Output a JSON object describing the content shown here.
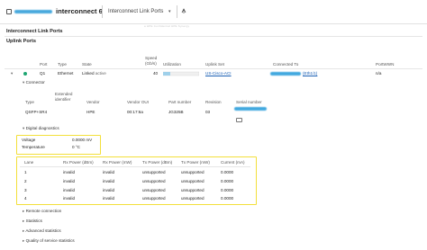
{
  "header": {
    "title": "interconnect 6",
    "breadcrumb": "Interconnect Link Ports",
    "caret": "▾",
    "watermark": "a HPE Confidential HPE Synergy"
  },
  "page_title": "Interconnect Link Ports",
  "section_title": "Uplink Ports",
  "uplink_table": {
    "columns": {
      "port": "Port",
      "type": "Type",
      "state": "State",
      "speed": "Speed\n(Gb/s)",
      "utilization": "Utilization",
      "uplink_set": "Uplink Set",
      "connected_to": "Connected To",
      "port_wwn": "PortWWN"
    },
    "row": {
      "port": "Q1",
      "type": "Ethernet",
      "state": "Linked",
      "state_suffix": "active",
      "speed": "40",
      "uplink_set": "US-Cisco-ACI",
      "connected_to_suffix": "(Eth1/1)",
      "port_wwn": "n/a"
    }
  },
  "connector": {
    "label": "Connector",
    "columns": [
      "Type",
      "Extended\nidentifier",
      "Vendor",
      "Vendor OUI",
      "Part number",
      "Revision",
      "Serial number"
    ],
    "values": [
      "QSFP+SR4",
      "",
      "HPE",
      "00:17:6a",
      "JG325B",
      "03",
      ""
    ]
  },
  "digital_diagnostics": {
    "label": "Digital diagnostics",
    "voltage_label": "Voltage",
    "voltage_value": "0.0000 mV",
    "temperature_label": "Temperature",
    "temperature_value": "0 °C",
    "lanes_header": [
      "Lane",
      "Rx Power (dBm)",
      "Rx Power (mW)",
      "Tx Power (dBm)",
      "Tx Power (mW)",
      "Current (mA)"
    ],
    "lanes": [
      [
        "1",
        "invalid",
        "invalid",
        "unsupported",
        "unsupported",
        "0.0000"
      ],
      [
        "2",
        "invalid",
        "invalid",
        "unsupported",
        "unsupported",
        "0.0000"
      ],
      [
        "3",
        "invalid",
        "invalid",
        "unsupported",
        "unsupported",
        "0.0000"
      ],
      [
        "4",
        "invalid",
        "invalid",
        "unsupported",
        "unsupported",
        "0.0000"
      ]
    ]
  },
  "collapsed_sections": [
    "Remote connection",
    "Statistics",
    "Advanced statistics",
    "Quality of service statistics"
  ],
  "colors": {
    "accent": "#1a5fb4",
    "status_ok": "#1ea672",
    "highlight": "#f3df3a",
    "redaction": "#2a9bd8"
  }
}
